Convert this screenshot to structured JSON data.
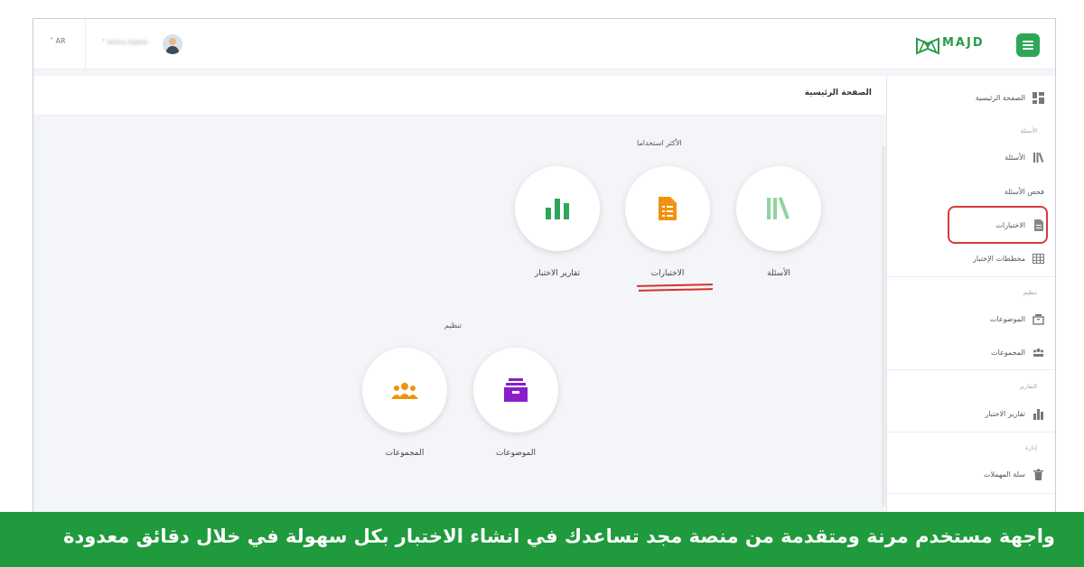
{
  "header": {
    "lang": "AR",
    "user_name": "Amira Salem",
    "brand": "MAJD"
  },
  "colors": {
    "brand_green": "#2fa657",
    "highlight_red": "#d93a3a",
    "tests_orange": "#f0920f",
    "questions_green": "#8fd4a0",
    "reports_green": "#2fa657",
    "topics_purple": "#8a1fc9",
    "groups_orange": "#f0920f",
    "banner_green": "#1f9a3c"
  },
  "page_title": "الصفحة الرئيسية",
  "sidebar": {
    "home": "الصفحة الرئيسية",
    "section_questions": "الأسئلة",
    "questions": "الأسئلة",
    "check_questions": "فحص الأسئلة",
    "tests": "الاختبارات",
    "test_plans": "مخططات الإختبار",
    "section_organize": "تنظيم",
    "topics": "الموضوعات",
    "groups": "المجموعات",
    "section_reports": "التقارير",
    "test_reports": "تقارير الاختبار",
    "section_admin": "إدارة",
    "recycle_bin": "سلة المهملات",
    "icons": [
      "dashboard-icon",
      "books-icon",
      "document-icon",
      "table-icon",
      "archive-icon",
      "group-icon",
      "bar-chart-icon",
      "trash-icon"
    ]
  },
  "main": {
    "most_used_label": "الأكثر استخداما",
    "organize_label": "تنظيم",
    "tiles": {
      "questions": "الأسئلة",
      "tests": "الاختبارات",
      "test_reports": "تقارير الاختبار",
      "topics": "الموضوعات",
      "groups": "المجموعات"
    }
  },
  "banner": {
    "text": "واجهة مستخدم مرنة ومتقدمة من منصة مجد تساعدك في انشاء الاختبار بكل سهولة في خلال دقائق معدودة"
  }
}
